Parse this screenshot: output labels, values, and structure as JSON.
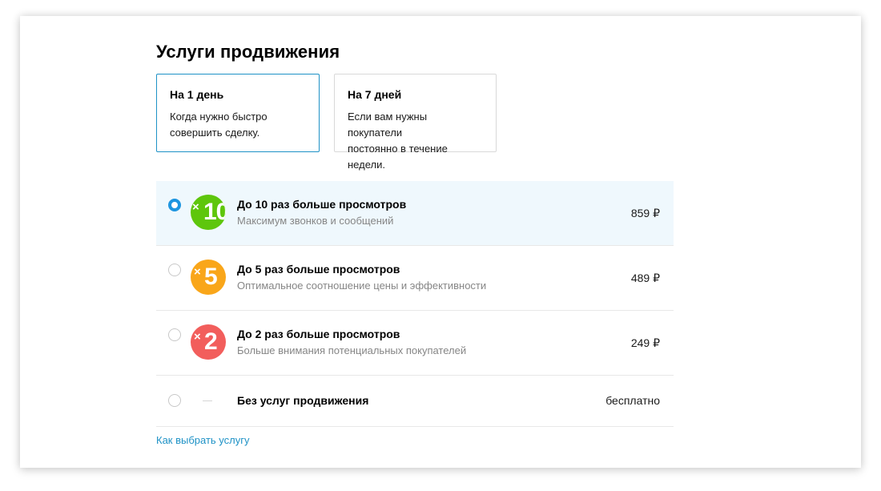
{
  "page": {
    "title": "Услуги продвижения"
  },
  "tabs": [
    {
      "title": "На 1 день",
      "desc_line1": "Когда нужно быстро",
      "desc_line2": "совершить сделку.",
      "active": true
    },
    {
      "title": "На 7 дней",
      "desc_line1": "Если вам нужны покупатели",
      "desc_line2": "постоянно в течение недели.",
      "active": false
    }
  ],
  "options": [
    {
      "badge_x": "×",
      "badge_number": "10",
      "badge_color": "#5ec60c",
      "title": "До 10 раз больше просмотров",
      "subtitle": "Максимум звонков и сообщений",
      "price": "859 ₽",
      "selected": true
    },
    {
      "badge_x": "×",
      "badge_number": "5",
      "badge_color": "#f9a61a",
      "title": "До 5 раз больше просмотров",
      "subtitle": "Оптимальное соотношение цены и эффективности",
      "price": "489 ₽",
      "selected": false
    },
    {
      "badge_x": "×",
      "badge_number": "2",
      "badge_color": "#f25e5c",
      "title": "До 2 раз больше просмотров",
      "subtitle": "Больше внимания потенциальных покупателей",
      "price": "249 ₽",
      "selected": false
    },
    {
      "title": "Без услуг продвижения",
      "price": "бесплатно",
      "selected": false
    }
  ],
  "help_link": "Как выбрать услугу",
  "colors": {
    "accent": "#1f92c6",
    "radio_active": "#1d95e0",
    "selected_row_bg": "#eff8fd"
  }
}
